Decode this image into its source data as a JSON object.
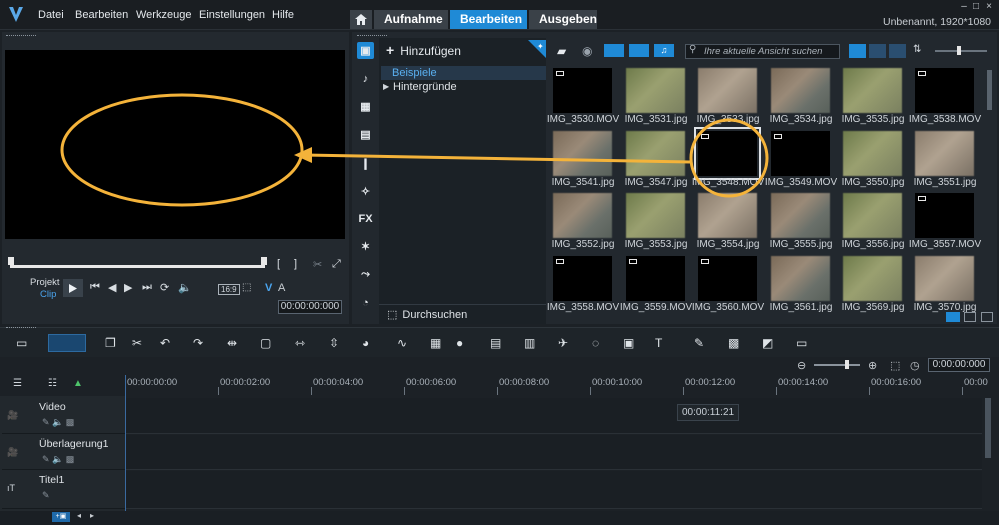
{
  "menu": [
    "Datei",
    "Bearbeiten",
    "Werkzeuge",
    "Einstellungen",
    "Hilfe"
  ],
  "tabs": [
    "Aufnahme",
    "Bearbeiten",
    "Ausgeben"
  ],
  "active_tab": "Bearbeiten",
  "window_title": "Unbenannt, 1920*1080",
  "preview": {
    "project_label": "Projekt",
    "clip_label": "Clip",
    "timecode": "00:00:00:000",
    "aspect": "16:9",
    "v_label": "V",
    "a_label": "A"
  },
  "library": {
    "add_label": "Hinzufügen",
    "folders": [
      "Beispiele",
      "Hintergründe"
    ],
    "browse_label": "Durchsuchen",
    "search_placeholder": "Ihre aktuelle Ansicht suchen",
    "items": [
      {
        "label": "IMG_3530.MOV",
        "kind": "video"
      },
      {
        "label": "IMG_3531.jpg",
        "kind": "image"
      },
      {
        "label": "IMG_3533.jpg",
        "kind": "image"
      },
      {
        "label": "IMG_3534.jpg",
        "kind": "image"
      },
      {
        "label": "IMG_3535.jpg",
        "kind": "image"
      },
      {
        "label": "IMG_3538.MOV",
        "kind": "video"
      },
      {
        "label": "IMG_3541.jpg",
        "kind": "image"
      },
      {
        "label": "IMG_3547.jpg",
        "kind": "image"
      },
      {
        "label": "IMG_3548.MOV",
        "kind": "video"
      },
      {
        "label": "IMG_3549.MOV",
        "kind": "video"
      },
      {
        "label": "IMG_3550.jpg",
        "kind": "image"
      },
      {
        "label": "IMG_3551.jpg",
        "kind": "image"
      },
      {
        "label": "IMG_3552.jpg",
        "kind": "image"
      },
      {
        "label": "IMG_3553.jpg",
        "kind": "image"
      },
      {
        "label": "IMG_3554.jpg",
        "kind": "image"
      },
      {
        "label": "IMG_3555.jpg",
        "kind": "image"
      },
      {
        "label": "IMG_3556.jpg",
        "kind": "image"
      },
      {
        "label": "IMG_3557.MOV",
        "kind": "video"
      },
      {
        "label": "IMG_3558.MOV",
        "kind": "video"
      },
      {
        "label": "IMG_3559.MOV",
        "kind": "video"
      },
      {
        "label": "IMG_3560.MOV",
        "kind": "video"
      },
      {
        "label": "IMG_3561.jpg",
        "kind": "image"
      },
      {
        "label": "IMG_3569.jpg",
        "kind": "image"
      },
      {
        "label": "IMG_3570.jpg",
        "kind": "image"
      }
    ]
  },
  "timeline": {
    "timecode": "0:00:00:000",
    "ticks": [
      "00:00:00:00",
      "00:00:02:00",
      "00:00:04:00",
      "00:00:06:00",
      "00:00:08:00",
      "00:00:10:00",
      "00:00:12:00",
      "00:00:14:00",
      "00:00:16:00",
      "00:00"
    ],
    "tracks": [
      "Video",
      "Überlagerung1",
      "Titel1"
    ],
    "tooltip": "00:00:11:21"
  },
  "colors": {
    "accent": "#1f8ad6",
    "annotation": "#f4b33a"
  }
}
